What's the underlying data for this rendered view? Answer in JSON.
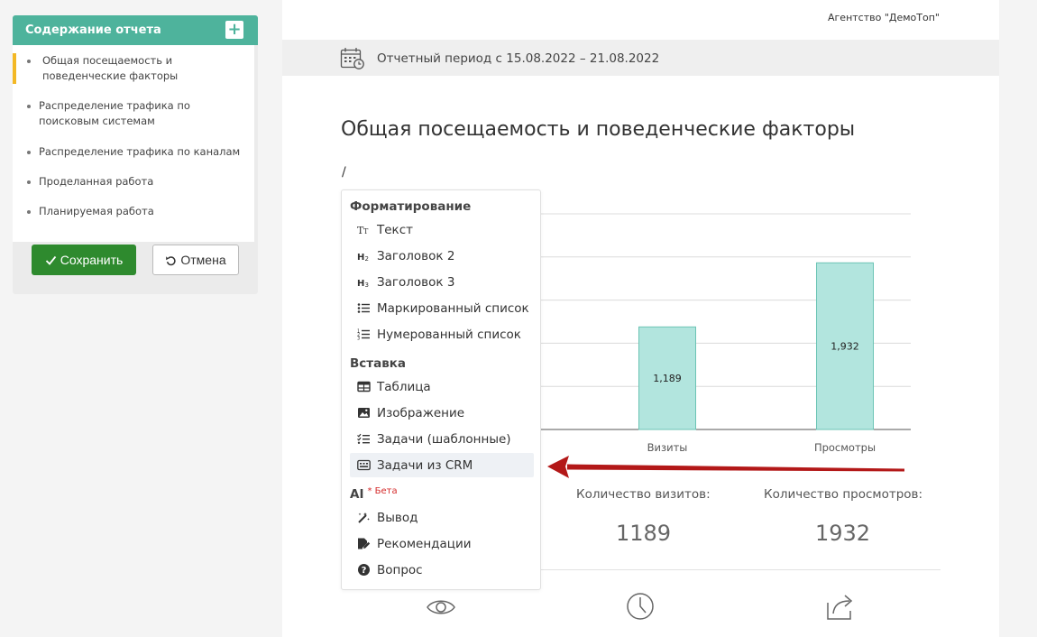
{
  "sidebar": {
    "title": "Содержание отчета",
    "add_label": "+",
    "items": [
      {
        "label": "Общая посещаемость и поведенческие факторы",
        "active": true
      },
      {
        "label": "Распределение трафика по поисковым системам"
      },
      {
        "label": "Распределение трафика по каналам"
      },
      {
        "label": "Проделанная работа"
      },
      {
        "label": "Планируемая работа"
      }
    ],
    "save_label": "Сохранить",
    "cancel_label": "Отмена"
  },
  "document": {
    "agency": "Агентство \"ДемоТоп\"",
    "period": "Отчетный период с 15.08.2022 – 21.08.2022",
    "title": "Общая посещаемость и поведенческие факторы",
    "slash": "/",
    "stats": [
      {
        "label": "Количество визитов:",
        "value": "1189"
      },
      {
        "label": "Количество просмотров:",
        "value": "1932"
      }
    ]
  },
  "menu": {
    "sections": {
      "formatting": "Форматирование",
      "insert": "Вставка",
      "ai": "AI",
      "ai_beta": "* Бета"
    },
    "formatting_items": [
      {
        "label": "Текст",
        "icon": "text-icon"
      },
      {
        "label": "Заголовок 2",
        "icon": "heading2-icon"
      },
      {
        "label": "Заголовок 3",
        "icon": "heading3-icon"
      },
      {
        "label": "Маркированный список",
        "icon": "bullet-list-icon"
      },
      {
        "label": "Нумерованный список",
        "icon": "numbered-list-icon"
      }
    ],
    "insert_items": [
      {
        "label": "Таблица",
        "icon": "table-icon"
      },
      {
        "label": "Изображение",
        "icon": "image-icon"
      },
      {
        "label": "Задачи (шаблонные)",
        "icon": "checklist-icon"
      },
      {
        "label": "Задачи из CRM",
        "icon": "crm-icon",
        "highlighted": true
      }
    ],
    "ai_items": [
      {
        "label": "Вывод",
        "icon": "magic-wand-icon"
      },
      {
        "label": "Рекомендации",
        "icon": "edit-document-icon"
      },
      {
        "label": "Вопрос",
        "icon": "question-icon"
      }
    ]
  },
  "colors": {
    "accent": "#4eb39c",
    "save": "#2e8a2e",
    "bar_fill": "#b2e5de",
    "bar_stroke": "#6cc4b5",
    "arrow": "#b31818"
  },
  "chart_data": {
    "type": "bar",
    "categories": [
      "Визиты",
      "Просмотры"
    ],
    "values": [
      1189,
      1932
    ],
    "data_labels": [
      "1,189",
      "1,932"
    ],
    "ylim": [
      0,
      2500
    ],
    "grid": true
  }
}
